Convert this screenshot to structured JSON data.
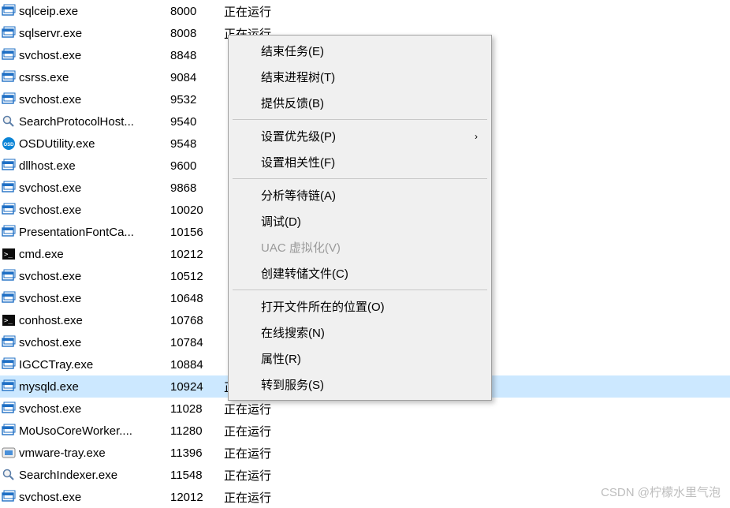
{
  "processes": [
    {
      "icon": "window",
      "name": "sqlceip.exe",
      "pid": "8000",
      "status": "正在运行",
      "selected": false
    },
    {
      "icon": "window",
      "name": "sqlservr.exe",
      "pid": "8008",
      "status": "正在运行",
      "selected": false
    },
    {
      "icon": "window",
      "name": "svchost.exe",
      "pid": "8848",
      "status": "",
      "selected": false
    },
    {
      "icon": "window",
      "name": "csrss.exe",
      "pid": "9084",
      "status": "",
      "selected": false
    },
    {
      "icon": "window",
      "name": "svchost.exe",
      "pid": "9532",
      "status": "",
      "selected": false
    },
    {
      "icon": "search",
      "name": "SearchProtocolHost...",
      "pid": "9540",
      "status": "",
      "selected": false
    },
    {
      "icon": "osd",
      "name": "OSDUtility.exe",
      "pid": "9548",
      "status": "",
      "selected": false
    },
    {
      "icon": "window",
      "name": "dllhost.exe",
      "pid": "9600",
      "status": "",
      "selected": false
    },
    {
      "icon": "window",
      "name": "svchost.exe",
      "pid": "9868",
      "status": "",
      "selected": false
    },
    {
      "icon": "window",
      "name": "svchost.exe",
      "pid": "10020",
      "status": "",
      "selected": false
    },
    {
      "icon": "window",
      "name": "PresentationFontCa...",
      "pid": "10156",
      "status": "",
      "selected": false
    },
    {
      "icon": "cmd",
      "name": "cmd.exe",
      "pid": "10212",
      "status": "",
      "selected": false
    },
    {
      "icon": "window",
      "name": "svchost.exe",
      "pid": "10512",
      "status": "",
      "selected": false
    },
    {
      "icon": "window",
      "name": "svchost.exe",
      "pid": "10648",
      "status": "",
      "selected": false
    },
    {
      "icon": "cmd",
      "name": "conhost.exe",
      "pid": "10768",
      "status": "",
      "selected": false
    },
    {
      "icon": "window",
      "name": "svchost.exe",
      "pid": "10784",
      "status": "",
      "selected": false
    },
    {
      "icon": "window",
      "name": "IGCCTray.exe",
      "pid": "10884",
      "status": "",
      "selected": false
    },
    {
      "icon": "window",
      "name": "mysqld.exe",
      "pid": "10924",
      "status": "正在运行",
      "selected": true
    },
    {
      "icon": "window",
      "name": "svchost.exe",
      "pid": "11028",
      "status": "正在运行",
      "selected": false
    },
    {
      "icon": "window",
      "name": "MoUsoCoreWorker....",
      "pid": "11280",
      "status": "正在运行",
      "selected": false
    },
    {
      "icon": "vmware",
      "name": "vmware-tray.exe",
      "pid": "11396",
      "status": "正在运行",
      "selected": false
    },
    {
      "icon": "search",
      "name": "SearchIndexer.exe",
      "pid": "11548",
      "status": "正在运行",
      "selected": false
    },
    {
      "icon": "window",
      "name": "svchost.exe",
      "pid": "12012",
      "status": "正在运行",
      "selected": false
    }
  ],
  "menu": {
    "groups": [
      [
        {
          "label": "结束任务(E)",
          "disabled": false,
          "submenu": false
        },
        {
          "label": "结束进程树(T)",
          "disabled": false,
          "submenu": false
        },
        {
          "label": "提供反馈(B)",
          "disabled": false,
          "submenu": false
        }
      ],
      [
        {
          "label": "设置优先级(P)",
          "disabled": false,
          "submenu": true
        },
        {
          "label": "设置相关性(F)",
          "disabled": false,
          "submenu": false
        }
      ],
      [
        {
          "label": "分析等待链(A)",
          "disabled": false,
          "submenu": false
        },
        {
          "label": "调试(D)",
          "disabled": false,
          "submenu": false
        },
        {
          "label": "UAC 虚拟化(V)",
          "disabled": true,
          "submenu": false
        },
        {
          "label": "创建转储文件(C)",
          "disabled": false,
          "submenu": false
        }
      ],
      [
        {
          "label": "打开文件所在的位置(O)",
          "disabled": false,
          "submenu": false
        },
        {
          "label": "在线搜索(N)",
          "disabled": false,
          "submenu": false
        },
        {
          "label": "属性(R)",
          "disabled": false,
          "submenu": false
        },
        {
          "label": "转到服务(S)",
          "disabled": false,
          "submenu": false
        }
      ]
    ]
  },
  "watermark": "CSDN @柠檬水里气泡",
  "icons": {
    "submenu_arrow": "›"
  }
}
